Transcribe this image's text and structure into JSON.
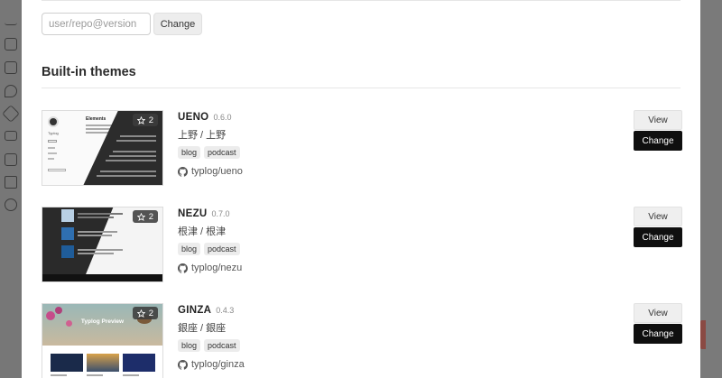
{
  "install": {
    "placeholder": "user/repo@version",
    "change_label": "Change"
  },
  "section_title": "Built-in themes",
  "themes": [
    {
      "name": "UENO",
      "version": "0.6.0",
      "jp": "上野 / 上野",
      "tags": [
        "blog",
        "podcast"
      ],
      "repo": "typlog/ueno",
      "stars": "2",
      "view_label": "View",
      "change_label": "Change",
      "thumb_heading": "Elements",
      "thumb_brand": "Typlog"
    },
    {
      "name": "NEZU",
      "version": "0.7.0",
      "jp": "根津 / 根津",
      "tags": [
        "blog",
        "podcast"
      ],
      "repo": "typlog/nezu",
      "stars": "2",
      "view_label": "View",
      "change_label": "Change"
    },
    {
      "name": "GINZA",
      "version": "0.4.3",
      "jp": "銀座 / 銀座",
      "tags": [
        "blog",
        "podcast"
      ],
      "repo": "typlog/ginza",
      "stars": "2",
      "view_label": "View",
      "change_label": "Change",
      "thumb_title": "Typlog Preview"
    }
  ],
  "colors": {
    "primary_button": "#0f0f0f",
    "secondary_button": "#efefef",
    "overlay": "#6b6b6b"
  },
  "icons": {
    "star": "star-icon",
    "repo": "github-icon"
  }
}
